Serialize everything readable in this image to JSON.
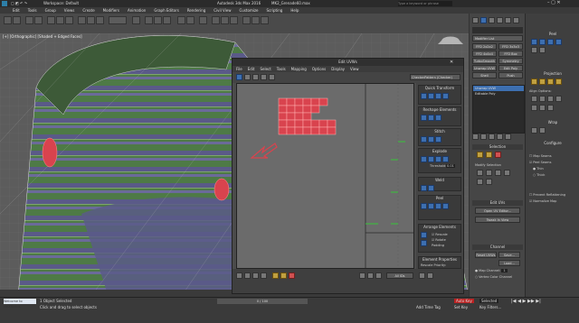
{
  "app": {
    "workspace_label": "Workspace: Default",
    "app_title": "Autodesk 3ds Max 2016",
    "file_name": "MK2_Grenade60.max",
    "search_placeholder": "Type a keyword or phrase"
  },
  "menu": [
    "Edit",
    "Tools",
    "Group",
    "Views",
    "Create",
    "Modifiers",
    "Animation",
    "Graph Editors",
    "Rendering",
    "Civil View",
    "Customize",
    "Scripting",
    "Help"
  ],
  "viewport": {
    "label": "[+] [Orthographic] [Shaded + Edged Faces]"
  },
  "uv_editor": {
    "title": "Edit UVWs",
    "menu": [
      "File",
      "Edit",
      "Select",
      "Tools",
      "Mapping",
      "Options",
      "Display",
      "View"
    ],
    "map_dropdown": "CheckerPattern (Checker)",
    "sections": [
      "Quick Transform",
      "Reshape Elements",
      "Stitch",
      "Explode",
      "Weld",
      "Peel",
      "Arrange Elements",
      "Element Properties"
    ],
    "threshold_label": "Threshold:",
    "threshold_value": "0.01",
    "peel_button": "Peel",
    "rescale_label": "Rescale",
    "rotate_label": "Rotate",
    "padding_label": "Padding",
    "group_label": "Group:",
    "bottom_field": "All IDs",
    "rescale_priority_label": "Rescale Priority:"
  },
  "command_panel": {
    "modifier_list": "Modifier List",
    "buttons": [
      "FFD 2x2x2",
      "FFD 3x3x3",
      "FFD 4x4x4",
      "FFD Box",
      "TurboSmooth",
      "Symmetry",
      "Unwrap UVW",
      "Edit Poly",
      "Shell",
      "Push"
    ],
    "stack": [
      "Unwrap UVW",
      "Editable Poly"
    ],
    "selection_title": "Selection",
    "modify_sel": "Modify Selection",
    "edit_uvs": "Edit UVs",
    "open_uv_editor": "Open UV Editor...",
    "tweak_in_view": "Tweak In View",
    "channel_title": "Channel",
    "reset_uvws": "Reset UVWs",
    "save": "Save...",
    "load": "Load...",
    "map_channel_label": "Map Channel:",
    "map_channel_value": "1",
    "vertex_color_channel": "Vertex Color Channel"
  },
  "right_panel": {
    "peel_title": "Peel",
    "projection_title": "Projection",
    "align_options": "Align Options:",
    "wrap_title": "Wrap",
    "configure_title": "Configure",
    "map_seams": "Map Seams",
    "peel_seams": "Peel Seams",
    "thin": "Thin",
    "thick": "Thick",
    "prevent_reflattening": "Prevent Reflattening",
    "normalize_map": "Normalize Map"
  },
  "status": {
    "count": "1 Object Selected",
    "prompt": "Click and drag to select objects",
    "frame": "0 / 100",
    "add_time_tag": "Add Time Tag",
    "welcome": "Welcome to MAXScript.",
    "auto_key": "Auto Key",
    "selected": "Selected",
    "set_key": "Set Key",
    "key_filters": "Key Filters..."
  },
  "colors": {
    "uv_shell": "#d9434e",
    "uv_shell_edge": "#ff8080",
    "mesh_green": "#4f7a46",
    "mesh_purple": "#58557f"
  }
}
